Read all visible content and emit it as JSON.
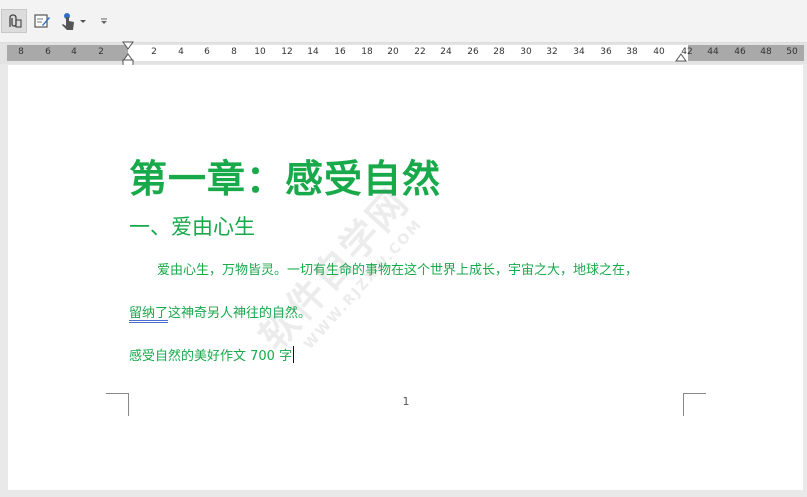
{
  "toolbar": {
    "buttons": [
      {
        "icon": "attach-icon"
      },
      {
        "icon": "edit-form-icon"
      },
      {
        "icon": "touch-mode-icon"
      },
      {
        "icon": "dropdown-arrow-icon"
      },
      {
        "icon": "customize-toolbar-icon"
      }
    ]
  },
  "ruler": {
    "left_numbers": [
      "8",
      "6",
      "4",
      "2"
    ],
    "right_numbers": [
      "2",
      "4",
      "6",
      "8",
      "10",
      "12",
      "14",
      "16",
      "18",
      "20",
      "22",
      "24",
      "26",
      "28",
      "30",
      "32",
      "34",
      "36",
      "38",
      "40",
      "42",
      "44",
      "46",
      "48",
      "50"
    ]
  },
  "document": {
    "title": "第一章：感受自然",
    "heading": "一、爱由心生",
    "paragraph1": "爱由心生，万物皆灵。一切有生命的事物在这个世界上成长，宇宙之大，地球之在，",
    "paragraph2_underlined": "留纳了",
    "paragraph2_rest": "这神奇另人神往的自然。",
    "paragraph3": "感受自然的美好作文 700 字",
    "page_number": "1",
    "text_color": "#18a94b"
  },
  "watermark": {
    "text": "软件自学网",
    "url": "WWW.RJZXW.COM"
  }
}
